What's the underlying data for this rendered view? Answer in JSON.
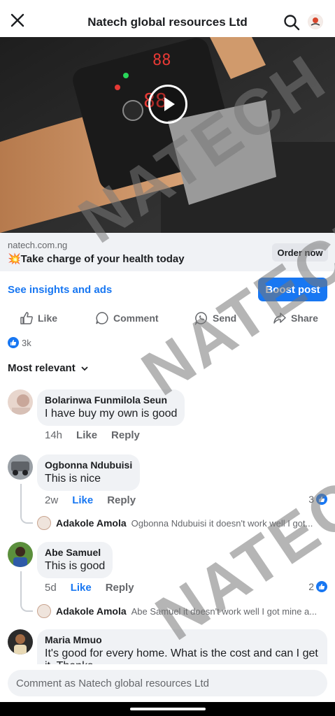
{
  "header": {
    "title": "Natech global resources Ltd"
  },
  "link_preview": {
    "domain": "natech.com.ng",
    "headline": "💥Take charge of your health today",
    "cta": "Order now"
  },
  "insights_link": "See insights and ads",
  "boost_button": "Boost post",
  "actions": {
    "like": "Like",
    "comment": "Comment",
    "send": "Send",
    "share": "Share"
  },
  "reaction_count": "3k",
  "sort_label": "Most relevant",
  "comments": [
    {
      "name": "Bolarinwa Funmilola Seun",
      "text": "I have buy my own is good",
      "time": "14h",
      "like": "Like",
      "reply": "Reply"
    },
    {
      "name": "Ogbonna Ndubuisi",
      "text": "This is nice",
      "time": "2w",
      "like": "Like",
      "reply": "Reply",
      "reactions": "3",
      "reply_preview": {
        "name": "Adakole Amola",
        "text": "Ogbonna Ndubuisi it doesn't work well I got..."
      }
    },
    {
      "name": "Abe Samuel",
      "text": "This is good",
      "time": "5d",
      "like": "Like",
      "reply": "Reply",
      "reactions": "2",
      "reply_preview": {
        "name": "Adakole Amola",
        "text": "Abe Samuel it doesn't work well I got mine a..."
      }
    },
    {
      "name": "Maria Mmuo",
      "text": "It's good for every home.  What is the  cost and can I get it. Thanks"
    }
  ],
  "composer_placeholder": "Comment as Natech global resources Ltd",
  "watermark": "NATECH",
  "colors": {
    "accent": "#1877f2",
    "secondary_text": "#65676b",
    "bubble": "#f0f2f5"
  }
}
